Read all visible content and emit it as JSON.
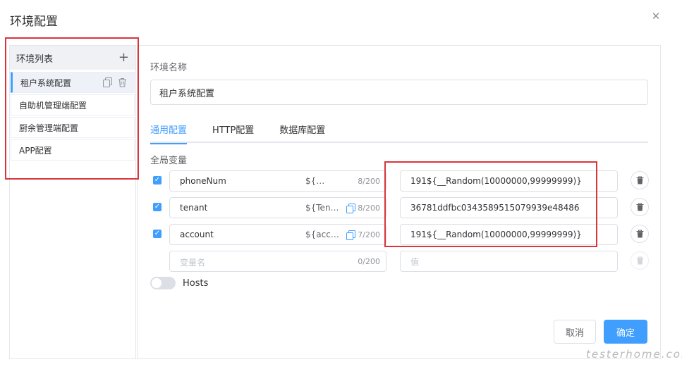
{
  "dialog": {
    "title": "环境配置"
  },
  "sidebar": {
    "header": "环境列表",
    "items": [
      {
        "label": "租户系统配置"
      },
      {
        "label": "自助机管理端配置"
      },
      {
        "label": "厨余管理端配置"
      },
      {
        "label": "APP配置"
      }
    ]
  },
  "form": {
    "env_name_label": "环境名称",
    "env_name_value": "租户系统配置",
    "tabs": [
      {
        "label": "通用配置"
      },
      {
        "label": "HTTP配置"
      },
      {
        "label": "数据库配置"
      }
    ],
    "global_vars_label": "全局变量",
    "variables": [
      {
        "name": "phoneNum",
        "ref": "${…",
        "count": "8/200",
        "value": "191${__Random(10000000,99999999)}"
      },
      {
        "name": "tenant",
        "ref": "${Ten…",
        "count": "8/200",
        "value": "36781ddfbc0343589515079939e48486"
      },
      {
        "name": "account",
        "ref": "${acc…",
        "count": "7/200",
        "value": "191${__Random(10000000,99999999)}"
      }
    ],
    "new_var": {
      "name_placeholder": "变量名",
      "count": "0/200",
      "value_placeholder": "值"
    },
    "hosts_label": "Hosts",
    "cancel_label": "取消",
    "confirm_label": "确定"
  },
  "watermark": "testerhome.com",
  "colors": {
    "accent": "#409eff",
    "highlight_box": "#d9353b"
  }
}
